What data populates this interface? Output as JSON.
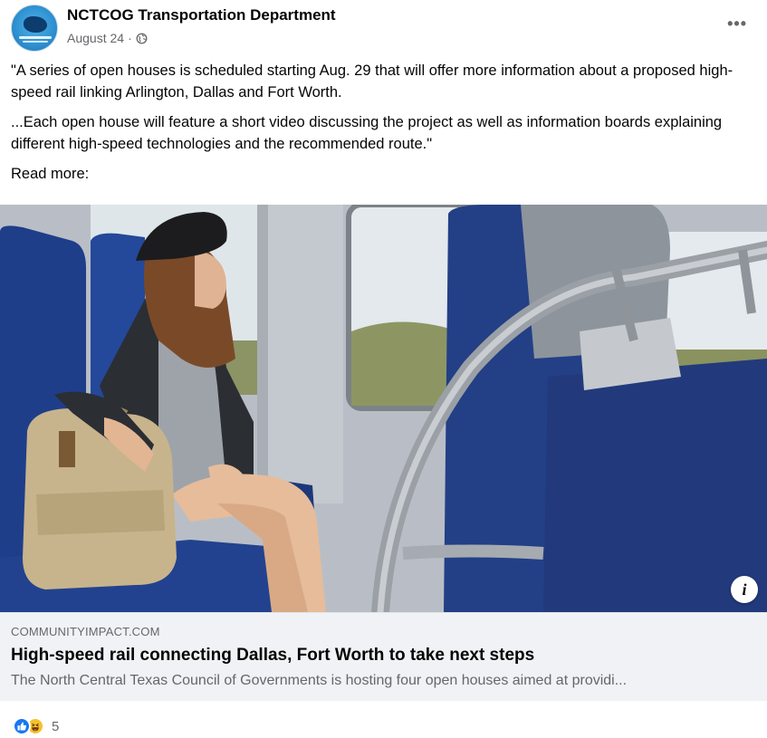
{
  "post": {
    "page_name": "NCTCOG Transportation Department",
    "date": "August 24",
    "separator": "·",
    "more_label": "•••",
    "paragraphs": [
      "\"A series of open houses is scheduled starting Aug. 29 that will offer more information about a proposed high-speed rail linking Arlington, Dallas and Fort Worth.",
      "...Each open house will feature a short video discussing the project as well as information boards explaining different high-speed technologies and the recommended route.\"",
      "Read more:"
    ]
  },
  "media": {
    "info_label": "i"
  },
  "link_preview": {
    "domain": "COMMUNITYIMPACT.COM",
    "title": "High-speed rail connecting Dallas, Fort Worth to take next steps",
    "description": "The North Central Texas Council of Governments is hosting four open houses aimed at providi..."
  },
  "reactions": {
    "types": [
      "like-icon",
      "haha-icon"
    ],
    "count": "5"
  },
  "colors": {
    "like": "#1877f2",
    "haha": "#f7c02b",
    "secondary_text": "#65676b",
    "card_bg": "#f0f2f5"
  }
}
